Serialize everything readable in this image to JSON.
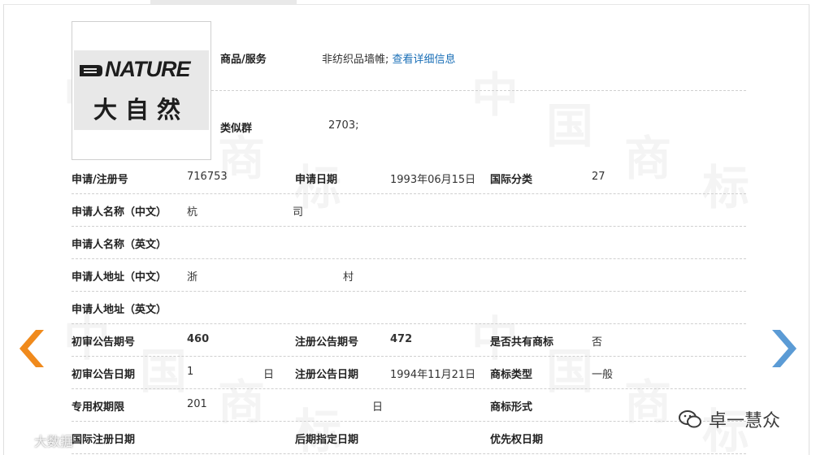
{
  "logo": {
    "english": "NATURE",
    "chinese": "大自然"
  },
  "goods": {
    "label": "商品/服务",
    "value": "非纺织品墙帷;",
    "link": "查看详细信息"
  },
  "similar": {
    "label": "类似群",
    "value": "2703;"
  },
  "rows": {
    "reg_no_label": "申请/注册号",
    "reg_no": "716753",
    "apply_date_label": "申请日期",
    "apply_date": "1993年06月15日",
    "intl_class_label": "国际分类",
    "intl_class": "27",
    "applicant_cn_label": "申请人名称（中文）",
    "applicant_cn_a": "杭",
    "applicant_cn_b": "司",
    "applicant_en_label": "申请人名称（英文）",
    "address_cn_label": "申请人地址（中文）",
    "address_cn_a": "浙",
    "address_cn_b": "村",
    "address_en_label": "申请人地址（英文）",
    "prelim_no_label": "初审公告期号",
    "prelim_no": "460",
    "reg_pub_no_label": "注册公告期号",
    "reg_pub_no": "472",
    "shared_label": "是否共有商标",
    "shared": "否",
    "prelim_date_label": "初审公告日期",
    "prelim_date_a": "1",
    "prelim_date_b": "日",
    "reg_pub_date_label": "注册公告日期",
    "reg_pub_date": "1994年11月21日",
    "tm_type_label": "商标类型",
    "tm_type": "一般",
    "exclusive_label": "专用权期限",
    "exclusive_a": "201",
    "exclusive_b": "日",
    "tm_form_label": "商标形式",
    "intl_reg_date_label": "国际注册日期",
    "later_date_label": "后期指定日期",
    "priority_date_label": "优先权日期"
  },
  "watermark_chars": [
    "中",
    "国",
    "商",
    "标"
  ],
  "overlay": {
    "wechat": "卓一慧众",
    "weibo": "大数据"
  },
  "colors": {
    "prev_arrow": "#f08a1c",
    "next_arrow": "#5b9bd5",
    "link": "#1a6fb7"
  }
}
